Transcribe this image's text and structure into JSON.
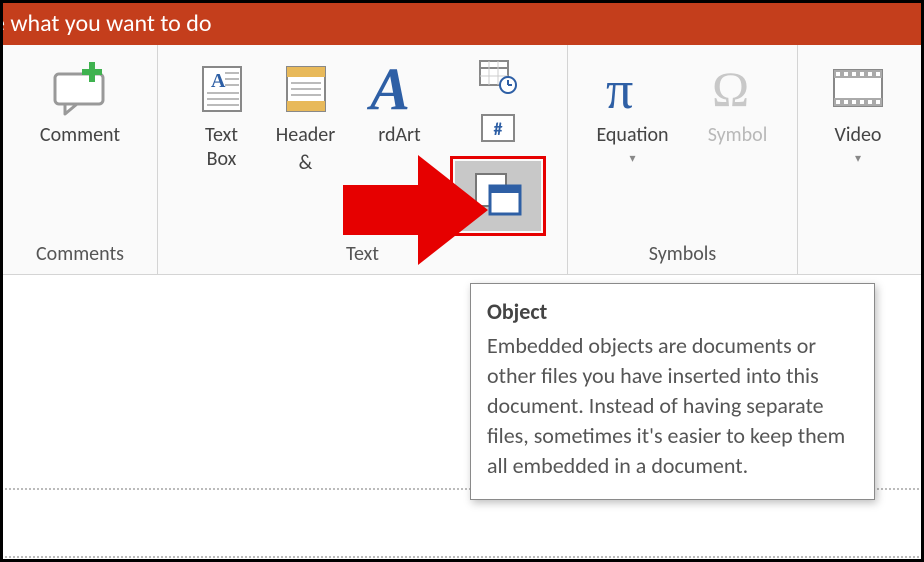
{
  "tellme_text": "e what you want to do",
  "groups": {
    "comments": {
      "label": "Comments",
      "comment_btn": "Comment"
    },
    "text": {
      "label": "Text",
      "textbox_btn": "Text\nBox",
      "header_btn": "Header",
      "wordart_btn": "rdArt",
      "header_footer_partial": "&"
    },
    "symbols": {
      "label": "Symbols",
      "equation_btn": "Equation",
      "symbol_btn": "Symbol"
    },
    "media": {
      "video_btn": "Video"
    }
  },
  "tooltip": {
    "title": "Object",
    "body": "Embedded objects are documents or other files you have inserted into this document. Instead of having separate files, sometimes it's easier to keep them all embedded in a document."
  }
}
